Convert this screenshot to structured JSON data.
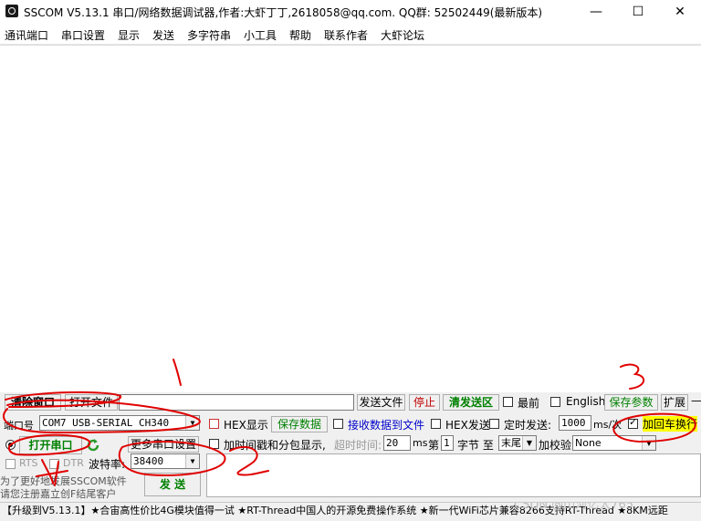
{
  "window": {
    "title": "SSCOM V5.13.1 串口/网络数据调试器,作者:大虾丁丁,2618058@qq.com. QQ群: 52502449(最新版本)",
    "minimize": "—",
    "maximize": "☐",
    "close": "✕"
  },
  "menu": [
    "通讯端口",
    "串口设置",
    "显示",
    "发送",
    "多字符串",
    "小工具",
    "帮助",
    "联系作者",
    "大虾论坛"
  ],
  "toolbar": {
    "clear_window": "清除窗口",
    "open_file": "打开文件",
    "send_file": "发送文件",
    "stop": "停止",
    "clear_send": "清发送区",
    "topmost": "最前",
    "english": "English",
    "save_params": "保存参数",
    "expand": "扩展",
    "dash": "—"
  },
  "port": {
    "label": "端口号",
    "value": "COM7 USB-SERIAL CH340",
    "more_settings": "更多串口设置",
    "open_button": "打开串口",
    "rts": "RTS",
    "dtr": "DTR",
    "baud_label": "波特率:",
    "baud_value": "38400"
  },
  "options": {
    "hex_display": "HEX显示",
    "save_data": "保存数据",
    "recv_to_file": "接收数据到文件",
    "hex_send": "HEX发送",
    "timed_send": "定时发送:",
    "interval_value": "1000",
    "interval_unit": "ms/次",
    "add_crlf": "加回车换行",
    "timestamp": "加时间戳和分包显示,",
    "timeout_label": "超时时间:",
    "timeout_value": "20",
    "timeout_unit": "ms",
    "byte_no_label": "第",
    "byte_no_value": "1",
    "byte_label": "字节 至",
    "end_value": "末尾",
    "checksum_label": "加校验",
    "checksum_value": "None"
  },
  "send": {
    "button": "发 送",
    "promo_line1": "为了更好地发展SSCOM软件",
    "promo_line2": "请您注册嘉立创F结尾客户"
  },
  "statusbar": {
    "text": "【升级到V5.13.1】★合宙高性价比4G模块值得一试 ★RT-Thread中国人的开源免费操作系统 ★新一代WiFi芯片兼容8266支持RT-Thread ★8KM远距",
    "watermark": "CSDN @山河亿太765"
  },
  "annotations": [
    "1",
    "2",
    "3",
    "4"
  ]
}
